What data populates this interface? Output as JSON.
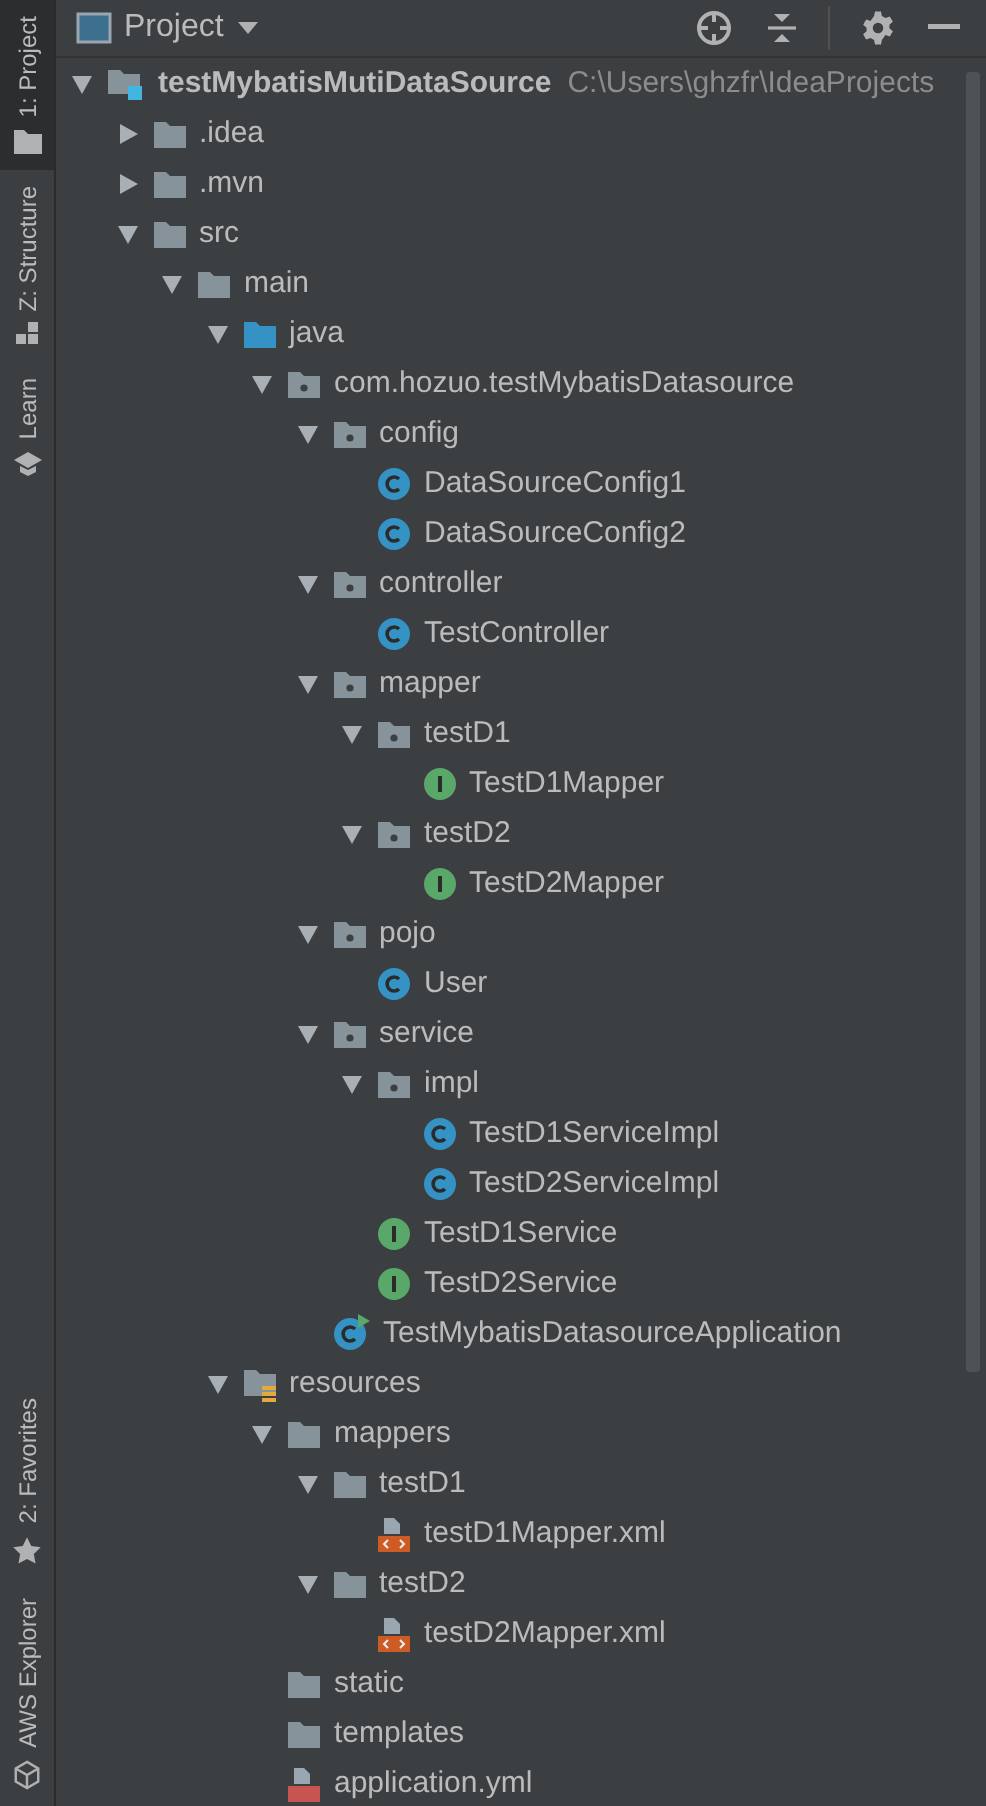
{
  "sidebar": {
    "top_items": [
      {
        "label": "1: Project",
        "kind": "folder",
        "selected": true
      },
      {
        "label": "Z: Structure",
        "kind": "structure",
        "selected": false
      },
      {
        "label": "Learn",
        "kind": "learn",
        "selected": false
      }
    ],
    "bottom_items": [
      {
        "label": "2: Favorites",
        "kind": "star",
        "selected": false
      },
      {
        "label": "AWS Explorer",
        "kind": "cube",
        "selected": false
      }
    ]
  },
  "panel": {
    "title": "Project"
  },
  "tree": [
    {
      "label": "testMybatisMutiDataSource",
      "path": "C:\\Users\\ghzfr\\IdeaProjects",
      "kind": "module",
      "expanded": true,
      "children": [
        {
          "label": ".idea",
          "kind": "folder",
          "expanded": false
        },
        {
          "label": ".mvn",
          "kind": "folder",
          "expanded": false
        },
        {
          "label": "src",
          "kind": "folder",
          "expanded": true,
          "children": [
            {
              "label": "main",
              "kind": "folder",
              "expanded": true,
              "children": [
                {
                  "label": "java",
                  "kind": "source",
                  "expanded": true,
                  "children": [
                    {
                      "label": "com.hozuo.testMybatisDatasource",
                      "kind": "package",
                      "expanded": true,
                      "children": [
                        {
                          "label": "config",
                          "kind": "package",
                          "expanded": true,
                          "children": [
                            {
                              "label": "DataSourceConfig1",
                              "kind": "class"
                            },
                            {
                              "label": "DataSourceConfig2",
                              "kind": "class"
                            }
                          ]
                        },
                        {
                          "label": "controller",
                          "kind": "package",
                          "expanded": true,
                          "children": [
                            {
                              "label": "TestController",
                              "kind": "class"
                            }
                          ]
                        },
                        {
                          "label": "mapper",
                          "kind": "package",
                          "expanded": true,
                          "children": [
                            {
                              "label": "testD1",
                              "kind": "package",
                              "expanded": true,
                              "children": [
                                {
                                  "label": "TestD1Mapper",
                                  "kind": "interface"
                                }
                              ]
                            },
                            {
                              "label": "testD2",
                              "kind": "package",
                              "expanded": true,
                              "children": [
                                {
                                  "label": "TestD2Mapper",
                                  "kind": "interface"
                                }
                              ]
                            }
                          ]
                        },
                        {
                          "label": "pojo",
                          "kind": "package",
                          "expanded": true,
                          "children": [
                            {
                              "label": "User",
                              "kind": "class"
                            }
                          ]
                        },
                        {
                          "label": "service",
                          "kind": "package",
                          "expanded": true,
                          "children": [
                            {
                              "label": "impl",
                              "kind": "package",
                              "expanded": true,
                              "children": [
                                {
                                  "label": "TestD1ServiceImpl",
                                  "kind": "class"
                                },
                                {
                                  "label": "TestD2ServiceImpl",
                                  "kind": "class"
                                }
                              ]
                            },
                            {
                              "label": "TestD1Service",
                              "kind": "interface"
                            },
                            {
                              "label": "TestD2Service",
                              "kind": "interface"
                            }
                          ]
                        },
                        {
                          "label": "TestMybatisDatasourceApplication",
                          "kind": "app"
                        }
                      ]
                    }
                  ]
                },
                {
                  "label": "resources",
                  "kind": "resources",
                  "expanded": true,
                  "children": [
                    {
                      "label": "mappers",
                      "kind": "folder",
                      "expanded": true,
                      "children": [
                        {
                          "label": "testD1",
                          "kind": "folder",
                          "expanded": true,
                          "children": [
                            {
                              "label": "testD1Mapper.xml",
                              "kind": "xml"
                            }
                          ]
                        },
                        {
                          "label": "testD2",
                          "kind": "folder",
                          "expanded": true,
                          "children": [
                            {
                              "label": "testD2Mapper.xml",
                              "kind": "xml"
                            }
                          ]
                        }
                      ]
                    },
                    {
                      "label": "static",
                      "kind": "folder"
                    },
                    {
                      "label": "templates",
                      "kind": "folder"
                    },
                    {
                      "label": "application.yml",
                      "kind": "yml"
                    }
                  ]
                }
              ]
            }
          ]
        }
      ]
    }
  ]
}
